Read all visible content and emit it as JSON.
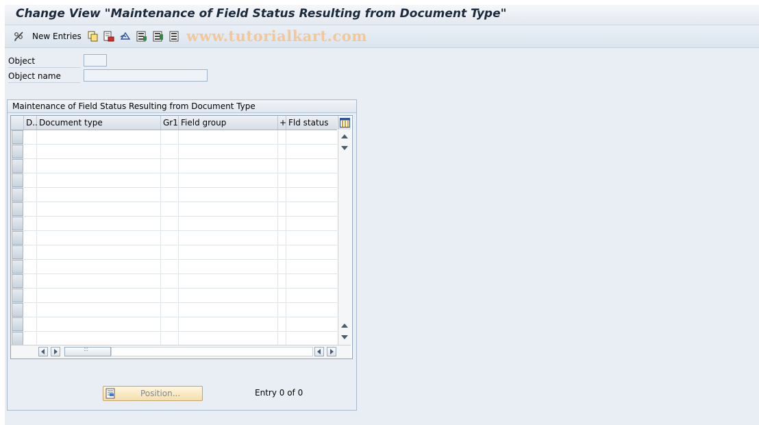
{
  "window": {
    "title": "Change View \"Maintenance of Field Status Resulting from Document Type\""
  },
  "toolbar": {
    "new_entries_label": "New Entries",
    "icons": [
      "pencil-glasses-icon",
      "copy-icon",
      "delete-icon",
      "undo-icon",
      "select-all-icon",
      "select-block-icon",
      "deselect-all-icon"
    ],
    "watermark": "www.tutorialkart.com"
  },
  "fields": {
    "object_label": "Object",
    "object_value": "",
    "object_name_label": "Object name",
    "object_name_value": ""
  },
  "table_group": {
    "title": "Maintenance of Field Status Resulting from Document Type",
    "columns": [
      "D..",
      "Document type",
      "Gr1",
      "Field group",
      "+",
      "Fld status"
    ],
    "rows": [],
    "visible_row_count": 15
  },
  "footer": {
    "position_label": "Position...",
    "entry_text": "Entry 0 of 0"
  },
  "colors": {
    "background": "#e9eef4",
    "title_text": "#1b2a3a",
    "watermark": "#f2c79a",
    "position_button": "#f4dfae"
  }
}
